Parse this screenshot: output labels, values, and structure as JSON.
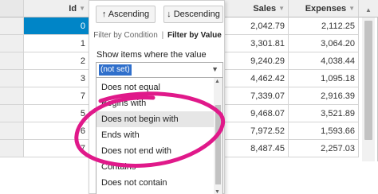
{
  "grid": {
    "columns": {
      "id": "Id",
      "sales": "Sales",
      "expenses": "Expenses"
    },
    "rows": [
      {
        "id": "0",
        "sales": "2,042.79",
        "expenses": "2,112.25"
      },
      {
        "id": "1",
        "sales": "3,301.81",
        "expenses": "3,064.20"
      },
      {
        "id": "2",
        "sales": "9,240.29",
        "expenses": "4,038.44"
      },
      {
        "id": "3",
        "sales": "4,462.42",
        "expenses": "1,095.18"
      },
      {
        "id": "7",
        "sales": "7,339.07",
        "expenses": "2,916.39"
      },
      {
        "id": "5",
        "sales": "9,468.07",
        "expenses": "3,521.89"
      },
      {
        "id": "6",
        "sales": "7,972.52",
        "expenses": "1,593.66"
      },
      {
        "id": "7",
        "sales": "8,487.45",
        "expenses": "2,257.03"
      }
    ],
    "selected_row": 0,
    "filter_glyph": "filter-icon"
  },
  "filter_popup": {
    "sort_ascending": "↑ Ascending",
    "sort_descending": "↓ Descending",
    "tab_condition": "Filter by Condition",
    "tab_separator": "|",
    "tab_value": "Filter by Value",
    "show_label": "Show items where the value",
    "combo_value": "(not set)",
    "operators": [
      "Does not equal",
      "Begins with",
      "Does not begin with",
      "Ends with",
      "Does not end with",
      "Contains",
      "Does not contain"
    ],
    "hovered_operator": 2
  },
  "colors": {
    "selection": "#0085c7",
    "annotation": "#e0198a"
  }
}
